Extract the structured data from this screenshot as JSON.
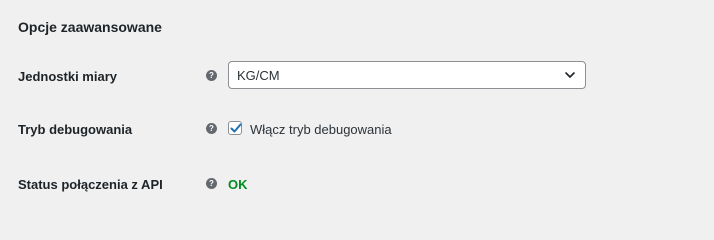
{
  "section": {
    "title": "Opcje zaawansowane"
  },
  "colors": {
    "status_ok": "#008a20",
    "checkbox_check": "#2271b1",
    "help_icon": "#646970"
  },
  "settings": {
    "units": {
      "label": "Jednostki miary",
      "help_icon": "question-mark",
      "selected_value": "KG/CM",
      "dropdown_icon": "chevron-down-icon"
    },
    "debug": {
      "label": "Tryb debugowania",
      "help_icon": "question-mark",
      "checkbox_label": "Włącz tryb debugowania",
      "checked": true
    },
    "api_status": {
      "label": "Status połączenia z API",
      "help_icon": "question-mark",
      "value": "OK"
    }
  }
}
